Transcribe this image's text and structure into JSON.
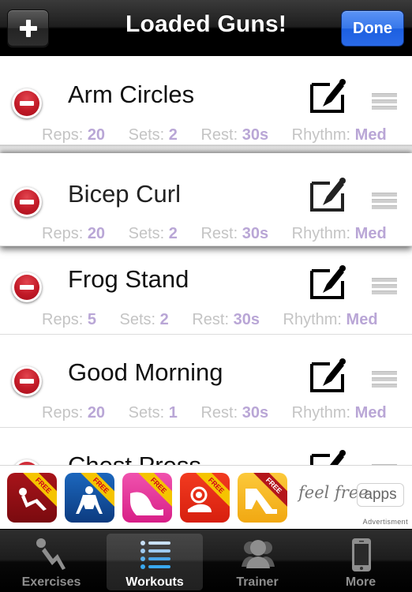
{
  "navbar": {
    "title": "Loaded Guns!",
    "add_icon": "plus-icon",
    "done_label": "Done"
  },
  "labels": {
    "reps": "Reps:",
    "sets": "Sets:",
    "rest": "Rest:",
    "rhythm": "Rhythm:"
  },
  "exercises": [
    {
      "name": "Arm Circles",
      "reps": "20",
      "sets": "2",
      "rest": "30s",
      "rhythm": "Med",
      "state": "normal"
    },
    {
      "name": "Bicep Curl",
      "reps": "20",
      "sets": "2",
      "rest": "30s",
      "rhythm": "Med",
      "state": "dragging"
    },
    {
      "name": "Frog Stand",
      "reps": "5",
      "sets": "2",
      "rest": "30s",
      "rhythm": "Med",
      "state": "normal"
    },
    {
      "name": "Good Morning",
      "reps": "20",
      "sets": "1",
      "rest": "30s",
      "rhythm": "Med",
      "state": "normal"
    },
    {
      "name": "Chest Press",
      "state": "partially-hidden"
    }
  ],
  "row_icons": {
    "delete": "minus-circle-icon",
    "edit": "edit-pencil-icon",
    "reorder": "reorder-handle-icon"
  },
  "ad": {
    "apps": [
      {
        "name": "abs-workout-app",
        "badge": "FREE",
        "color": "#8e0f14"
      },
      {
        "name": "pushups-workout-app",
        "badge": "FREE",
        "color": "#124f9c"
      },
      {
        "name": "butt-workout-app",
        "badge": "FREE",
        "color": "#ec2f9c"
      },
      {
        "name": "arm-workout-app",
        "badge": "FREE",
        "color": "#ea2e1a"
      },
      {
        "name": "leg-workout-app",
        "badge": "FREE",
        "color": "#f6b91a"
      }
    ],
    "brand": "feel free",
    "brand_box": "apps",
    "label": "Advertisment"
  },
  "tabs": [
    {
      "label": "Exercises",
      "icon": "exercise-person-icon",
      "active": false
    },
    {
      "label": "Workouts",
      "icon": "list-icon",
      "active": true
    },
    {
      "label": "Trainer",
      "icon": "people-icon",
      "active": false
    },
    {
      "label": "More",
      "icon": "phone-icon",
      "active": false
    }
  ]
}
